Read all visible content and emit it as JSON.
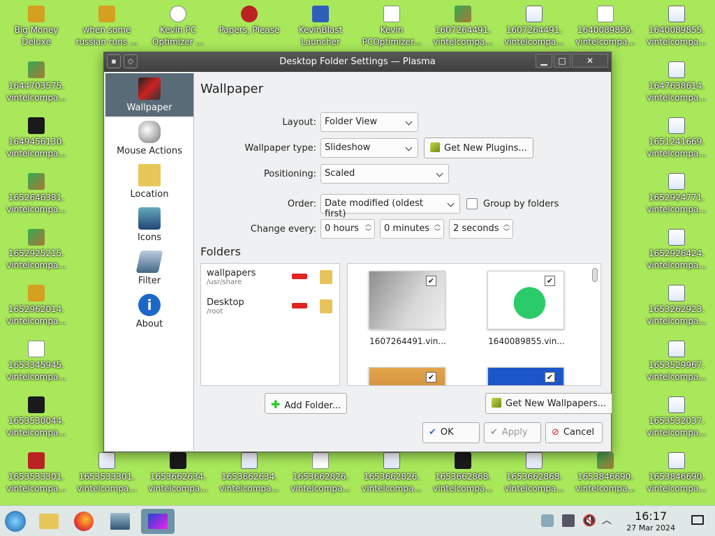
{
  "desktop": {
    "icons": [
      {
        "label1": "Big Money",
        "label2": "Deluxe"
      },
      {
        "label1": "when some",
        "label2": "russian runs ..."
      },
      {
        "label1": "Kevin PC",
        "label2": "Optimizer ..."
      },
      {
        "label1": "Papers, Please",
        "label2": ""
      },
      {
        "label1": "KevinBlast",
        "label2": "Launcher"
      },
      {
        "label1": "Kevin",
        "label2": "PCOptimizer..."
      },
      {
        "label1": "1607264491.",
        "label2": "vintelcompa..."
      },
      {
        "label1": "1607264491.",
        "label2": "vintelcompa..."
      },
      {
        "label1": "1640089855.",
        "label2": "vintelcompa..."
      },
      {
        "label1": "1640089855.",
        "label2": "vintelcompa..."
      },
      {
        "label1": "1644703575.",
        "label2": "vintelcompa..."
      },
      {
        "label1": "1649456130.",
        "label2": "vintelcompa..."
      },
      {
        "label1": "1652646381.",
        "label2": "vintelcompa..."
      },
      {
        "label1": "1652925215.",
        "label2": "vintelcompa..."
      },
      {
        "label1": "1652962014.",
        "label2": "vintelcompa..."
      },
      {
        "label1": "1653345945.",
        "label2": "vintelcompa..."
      },
      {
        "label1": "1653530044.",
        "label2": "vintelcompa..."
      },
      {
        "label1": "1653533301.",
        "label2": "vintelcompa..."
      },
      {
        "label1": "1647638614.",
        "label2": "vintelcompa..."
      },
      {
        "label1": "1651241669.",
        "label2": "vintelcompa..."
      },
      {
        "label1": "1652924771.",
        "label2": "vintelcompa..."
      },
      {
        "label1": "1652926424.",
        "label2": "vintelcompa..."
      },
      {
        "label1": "1653262923.",
        "label2": "vintelcompa..."
      },
      {
        "label1": "1653529967.",
        "label2": "vintelcompa..."
      },
      {
        "label1": "1653532037.",
        "label2": "vintelcompa..."
      },
      {
        "label1": "1653846690.",
        "label2": "vintelcompa..."
      },
      {
        "label1": "1653533301.",
        "label2": "vintelcompa..."
      },
      {
        "label1": "1653662634.",
        "label2": "vintelcompa..."
      },
      {
        "label1": "1653662634.",
        "label2": "vintelcompa..."
      },
      {
        "label1": "1653662826.",
        "label2": "vintelcompa..."
      },
      {
        "label1": "1653662826.",
        "label2": "vintelcompa..."
      },
      {
        "label1": "1653662868.",
        "label2": "vintelcompa..."
      },
      {
        "label1": "1653662868.",
        "label2": "vintelcompa..."
      },
      {
        "label1": "1653846690.",
        "label2": "vintelcompa..."
      }
    ]
  },
  "window": {
    "title": "Desktop Folder Settings — Plasma",
    "sidebar": [
      {
        "label": "Wallpaper"
      },
      {
        "label": "Mouse Actions"
      },
      {
        "label": "Location"
      },
      {
        "label": "Icons"
      },
      {
        "label": "Filter"
      },
      {
        "label": "About"
      }
    ],
    "page_title": "Wallpaper",
    "layout": {
      "label": "Layout:",
      "value": "Folder View"
    },
    "wallpaper_type": {
      "label": "Wallpaper type:",
      "value": "Slideshow",
      "plugins_button": "Get New Plugins..."
    },
    "positioning": {
      "label": "Positioning:",
      "value": "Scaled"
    },
    "order": {
      "label": "Order:",
      "value": "Date modified (oldest first)",
      "group_label": "Group by folders"
    },
    "change_every": {
      "label": "Change every:",
      "hours": "0 hours",
      "minutes": "0 minutes",
      "seconds": "2 seconds"
    },
    "folders_title": "Folders",
    "folders": [
      {
        "name": "wallpapers",
        "path": "/usr/share"
      },
      {
        "name": "Desktop",
        "path": "/root"
      }
    ],
    "thumbnails": [
      {
        "caption": "1607264491.vin..."
      },
      {
        "caption": "1640089855.vin..."
      },
      {
        "caption": ""
      },
      {
        "caption": ""
      }
    ],
    "add_folder": "Add Folder...",
    "get_wallpapers": "Get New Wallpapers...",
    "ok": "OK",
    "apply": "Apply",
    "cancel": "Cancel"
  },
  "taskbar": {
    "time": "16:17",
    "date": "27 Mar 2024"
  }
}
